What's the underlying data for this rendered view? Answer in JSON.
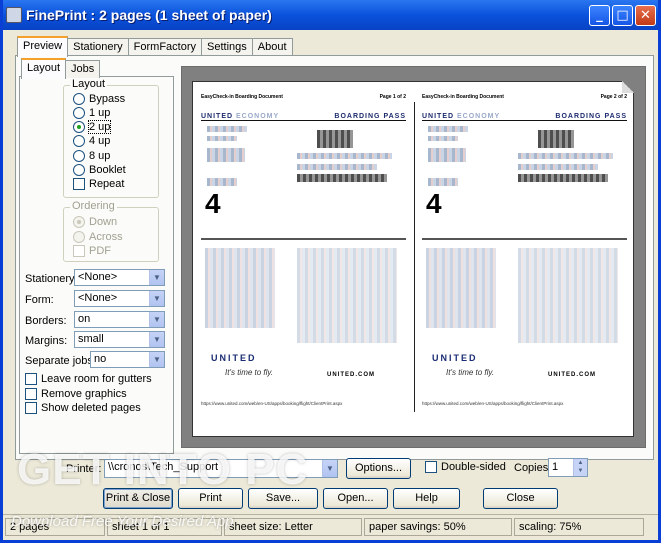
{
  "window": {
    "title": "FinePrint : 2 pages (1 sheet of paper)",
    "minimize": "_",
    "maximize": "□",
    "close": "✕"
  },
  "tabs": [
    "Preview",
    "Stationery",
    "FormFactory",
    "Settings",
    "About"
  ],
  "subtabs": [
    "Layout",
    "Jobs"
  ],
  "layout": {
    "legend": "Layout",
    "options": [
      "Bypass",
      "1 up",
      "2 up",
      "4 up",
      "8 up",
      "Booklet"
    ],
    "selected": "2 up",
    "repeat": "Repeat"
  },
  "ordering": {
    "legend": "Ordering",
    "options": [
      "Down",
      "Across"
    ],
    "pdf": "PDF"
  },
  "fields": {
    "stationery": {
      "label": "Stationery:",
      "value": "<None>"
    },
    "form": {
      "label": "Form:",
      "value": "<None>"
    },
    "borders": {
      "label": "Borders:",
      "value": "on"
    },
    "margins": {
      "label": "Margins:",
      "value": "small"
    },
    "separate_jobs": {
      "label": "Separate jobs:",
      "value": "no"
    }
  },
  "checks": [
    "Leave room for gutters",
    "Remove graphics",
    "Show deleted pages"
  ],
  "preview": {
    "page_left_header": "EasyCheck-in Boarding Document",
    "page_right_header": "Page 1 of 2",
    "page2_right_header": "Page 2 of 2",
    "airline": "UNITED",
    "airline_sub": "ECONOMY",
    "boarding_pass": "BOARDING PASS",
    "gate": "4",
    "logo": "UNITED",
    "tagline": "It's time to fly.",
    "url_right": "UNITED.COM",
    "footer_url": "https://www.united.com/web/en-US/apps/booking/flight/ClientPrint.aspx"
  },
  "printer": {
    "label": "Printer:",
    "value": "\\\\cronos\\Tech_Support",
    "options": "Options...",
    "double_sided": "Double-sided",
    "copies_label": "Copies:",
    "copies": "1"
  },
  "buttons": [
    "Print & Close",
    "Print",
    "Save...",
    "Open...",
    "Help",
    "Close"
  ],
  "status": {
    "pages": "2 pages",
    "sheet": "sheet 1 of 1",
    "sheet_size": "sheet size: Letter",
    "savings": "paper savings: 50%",
    "scaling": "scaling: 75%"
  },
  "watermark": {
    "text": "GET INTO PC",
    "sub": "Download Free Your Desired App"
  },
  "colors": {
    "title_blue": "#0a52dc",
    "tab_highlight": "#f3a12b",
    "radio_dot": "#21a121"
  }
}
